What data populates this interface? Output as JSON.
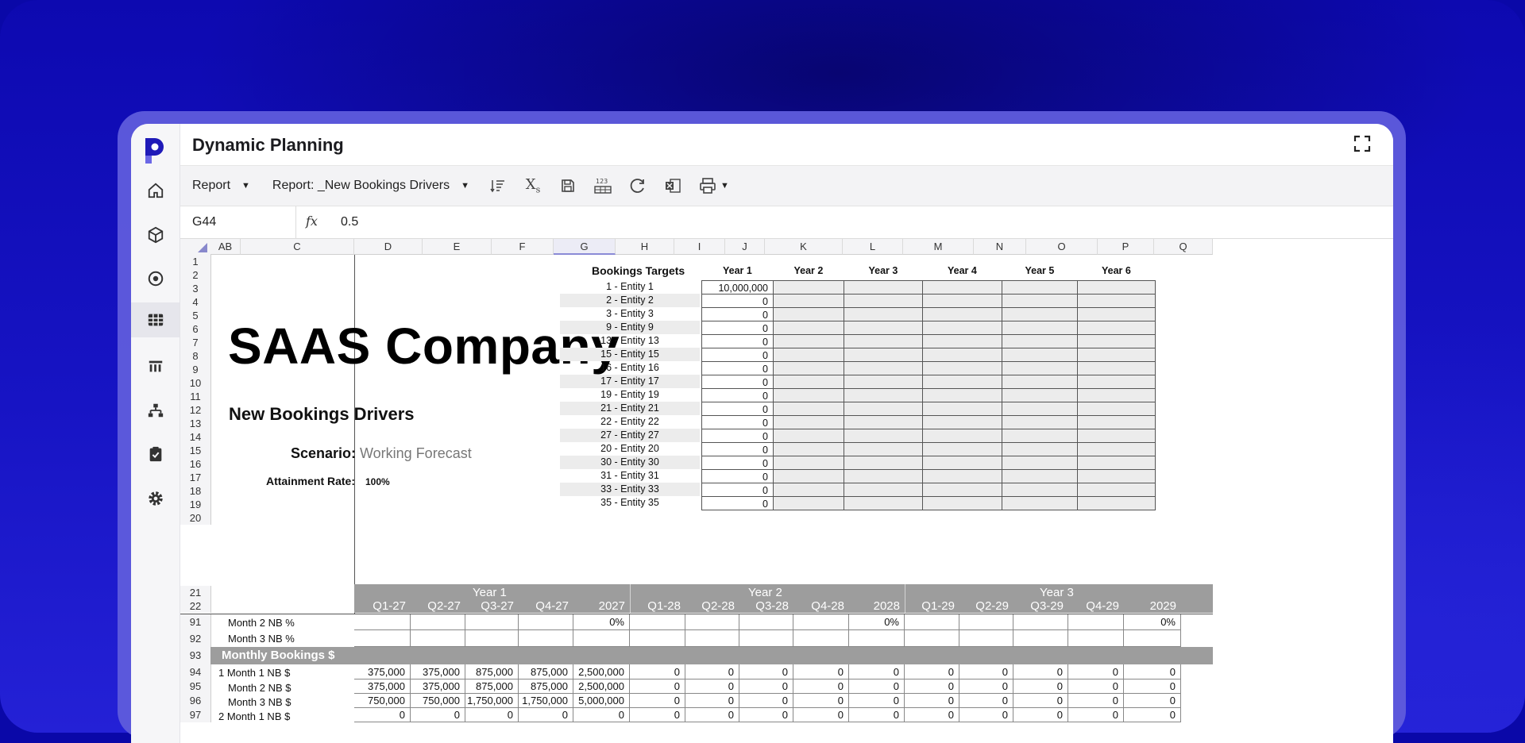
{
  "app": {
    "title": "Dynamic Planning"
  },
  "toolbar": {
    "report_label": "Report",
    "report_name": "Report: _New Bookings Drivers",
    "icons": [
      "sort-list-icon",
      "subscript-icon",
      "save-icon",
      "number-format-icon",
      "refresh-icon",
      "excel-export-icon",
      "print-icon"
    ]
  },
  "formula": {
    "cell_ref": "G44",
    "value": "0.5"
  },
  "columns": [
    "AB",
    "C",
    "D",
    "E",
    "F",
    "G",
    "H",
    "I",
    "J",
    "K",
    "L",
    "M",
    "N",
    "O",
    "P",
    "Q"
  ],
  "selected_column": "G",
  "rows_top": [
    "1",
    "2",
    "3",
    "4",
    "5",
    "6",
    "7",
    "8",
    "9",
    "10",
    "11",
    "12",
    "13",
    "14",
    "15",
    "16",
    "17",
    "18",
    "19",
    "20"
  ],
  "sheet": {
    "company": "SAAS Company",
    "subtitle": "New Bookings Drivers",
    "scenario_label": "Scenario:",
    "scenario_value": "Working Forecast",
    "attainment_label": "Attainment Rate:",
    "attainment_value": "100%"
  },
  "targets": {
    "title": "Bookings Targets",
    "years": [
      "Year 1",
      "Year 2",
      "Year 3",
      "Year 4",
      "Year 5",
      "Year 6"
    ],
    "entities": [
      {
        "name": "1 - Entity 1",
        "value": "10,000,000"
      },
      {
        "name": "2 - Entity 2",
        "value": "0"
      },
      {
        "name": "3 - Entity 3",
        "value": "0"
      },
      {
        "name": "9 - Entity 9",
        "value": "0"
      },
      {
        "name": "13 - Entity 13",
        "value": "0"
      },
      {
        "name": "15 - Entity 15",
        "value": "0"
      },
      {
        "name": "16 - Entity 16",
        "value": "0"
      },
      {
        "name": "17 - Entity 17",
        "value": "0"
      },
      {
        "name": "19 - Entity 19",
        "value": "0"
      },
      {
        "name": "21 - Entity 21",
        "value": "0"
      },
      {
        "name": "22 - Entity 22",
        "value": "0"
      },
      {
        "name": "27 - Entity 27",
        "value": "0"
      },
      {
        "name": "20 - Entity 20",
        "value": "0"
      },
      {
        "name": "30 - Entity 30",
        "value": "0"
      },
      {
        "name": "31 - Entity 31",
        "value": "0"
      },
      {
        "name": "33 - Entity 33",
        "value": "0"
      },
      {
        "name": "35 - Entity 35",
        "value": "0"
      }
    ]
  },
  "quarters": {
    "years": [
      "Year 1",
      "Year 2",
      "Year 3"
    ],
    "periods": [
      "Q1-27",
      "Q2-27",
      "Q3-27",
      "Q4-27",
      "2027",
      "Q1-28",
      "Q2-28",
      "Q3-28",
      "Q4-28",
      "2028",
      "Q1-29",
      "Q2-29",
      "Q3-29",
      "Q4-29",
      "2029"
    ]
  },
  "bottom_rows": [
    {
      "num": "21",
      "label": "",
      "values": []
    },
    {
      "num": "22",
      "label": "",
      "values": []
    },
    {
      "num": "91",
      "label": "Month 2 NB %",
      "values": [
        "",
        "",
        "",
        "",
        "0%",
        "",
        "",
        "",
        "",
        "0%",
        "",
        "",
        "",
        "",
        "0%"
      ]
    },
    {
      "num": "92",
      "label": "Month 3 NB %",
      "values": [
        "",
        "",
        "",
        "",
        "",
        "",
        "",
        "",
        "",
        "",
        "",
        "",
        "",
        "",
        ""
      ]
    },
    {
      "num": "93",
      "label": "Monthly Bookings $",
      "values": []
    },
    {
      "num": "94",
      "label": "1 Month 1 NB $",
      "values": [
        "375,000",
        "375,000",
        "875,000",
        "875,000",
        "2,500,000",
        "0",
        "0",
        "0",
        "0",
        "0",
        "0",
        "0",
        "0",
        "0",
        "0"
      ]
    },
    {
      "num": "95",
      "label": "Month 2 NB $",
      "values": [
        "375,000",
        "375,000",
        "875,000",
        "875,000",
        "2,500,000",
        "0",
        "0",
        "0",
        "0",
        "0",
        "0",
        "0",
        "0",
        "0",
        "0"
      ]
    },
    {
      "num": "96",
      "label": "Month 3 NB $",
      "values": [
        "750,000",
        "750,000",
        "1,750,000",
        "1,750,000",
        "5,000,000",
        "0",
        "0",
        "0",
        "0",
        "0",
        "0",
        "0",
        "0",
        "0",
        "0"
      ]
    },
    {
      "num": "97",
      "label": "2 Month 1 NB $",
      "values": [
        "0",
        "0",
        "0",
        "0",
        "0",
        "0",
        "0",
        "0",
        "0",
        "0",
        "0",
        "0",
        "0",
        "0",
        "0"
      ]
    }
  ]
}
